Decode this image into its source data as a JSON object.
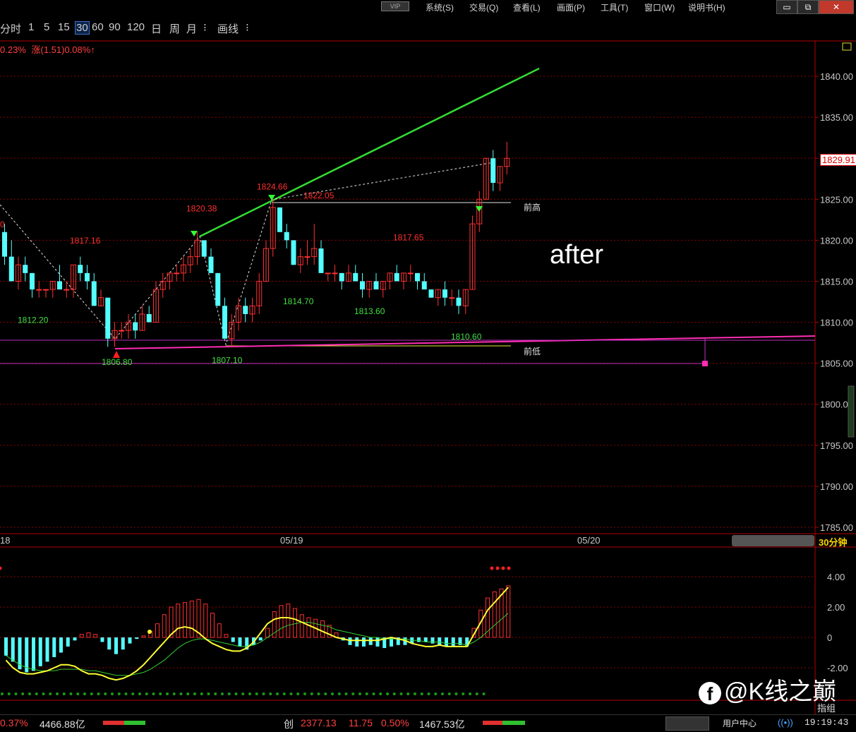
{
  "menu": {
    "vip": "VIP",
    "items": [
      "系统(S)",
      "交易(Q)",
      "查看(L)",
      "画面(P)",
      "工具(T)",
      "窗口(W)",
      "说明书(H)"
    ],
    "window_buttons": [
      "▭",
      "⧉",
      "✕"
    ]
  },
  "toolbar": {
    "items": [
      "分时",
      "1",
      "5",
      "15",
      "30",
      "60",
      "90",
      "120",
      "日",
      "周",
      "月",
      "⁝",
      "画线",
      "⁝"
    ],
    "selected": "30"
  },
  "info": {
    "left_pct": "0.23%",
    "change_label": "涨(1.51)",
    "change_pct": "0.08%",
    "arrow": "↑"
  },
  "chart_data": {
    "type": "candlestick",
    "price_axis": {
      "ticks": [
        "1840.00",
        "1835.00",
        "1830.00",
        "1825.00",
        "1820.00",
        "1815.00",
        "1810.00",
        "1805.00",
        "1800.00",
        "1795.00",
        "1790.00",
        "1785.00"
      ],
      "range": [
        1785,
        1841
      ],
      "current_price": "1829.91"
    },
    "date_labels": [
      "18",
      "05/19",
      "05/20"
    ],
    "period_label": "30分钟",
    "point_labels": [
      {
        "text": "1824.66",
        "price": 1826.2,
        "color": "#ff3030"
      },
      {
        "text": "1822.05",
        "price": 1825.1,
        "color": "#ff3030"
      },
      {
        "text": "1820.38",
        "price": 1823.5,
        "color": "#ff3030"
      },
      {
        "text": "1817.16",
        "price": 1819.6,
        "color": "#ff3030"
      },
      {
        "text": "1817.65",
        "price": 1820.0,
        "color": "#ff3030"
      },
      {
        "text": "1814.70",
        "price": 1812.2,
        "color": "#40e040"
      },
      {
        "text": "1813.60",
        "price": 1811.0,
        "color": "#40e040"
      },
      {
        "text": "1812.20",
        "price": 1809.9,
        "color": "#40e040"
      },
      {
        "text": "1810.60",
        "price": 1807.9,
        "color": "#40e040"
      },
      {
        "text": "1806.80",
        "price": 1804.8,
        "color": "#40e040"
      },
      {
        "text": "1807.10",
        "price": 1805.0,
        "color": "#40e040"
      },
      {
        "text": "0",
        "price": 1821.6,
        "color": "#ff3030"
      }
    ],
    "annotations": [
      {
        "text": "前高",
        "price": 1824.8
      },
      {
        "text": "前低",
        "price": 1807.1
      }
    ],
    "overlay_text": "after",
    "candles": [
      [
        1821,
        1822,
        1817,
        1818
      ],
      [
        1818,
        1820,
        1815,
        1815
      ],
      [
        1815,
        1818,
        1814,
        1817
      ],
      [
        1817,
        1818,
        1815,
        1816
      ],
      [
        1816,
        1816,
        1813,
        1814
      ],
      [
        1814,
        1815,
        1813,
        1814
      ],
      [
        1814,
        1814,
        1813,
        1814
      ],
      [
        1814,
        1815,
        1813,
        1815
      ],
      [
        1815,
        1817,
        1814,
        1814
      ],
      [
        1814,
        1815,
        1813,
        1814
      ],
      [
        1814,
        1817,
        1813,
        1817
      ],
      [
        1817,
        1818,
        1815,
        1816
      ],
      [
        1816,
        1817,
        1814,
        1815
      ],
      [
        1815,
        1816,
        1812,
        1812
      ],
      [
        1812,
        1814,
        1812,
        1813
      ],
      [
        1813,
        1813,
        1807,
        1808
      ],
      [
        1808,
        1810,
        1807,
        1809
      ],
      [
        1809,
        1810,
        1808,
        1809
      ],
      [
        1809,
        1811,
        1808,
        1810
      ],
      [
        1810,
        1811,
        1808,
        1809
      ],
      [
        1809,
        1812,
        1809,
        1811
      ],
      [
        1811,
        1812,
        1810,
        1810
      ],
      [
        1810,
        1815,
        1810,
        1814
      ],
      [
        1814,
        1816,
        1813,
        1815
      ],
      [
        1815,
        1816,
        1814,
        1816
      ],
      [
        1816,
        1817,
        1815,
        1816
      ],
      [
        1816,
        1818,
        1815,
        1817
      ],
      [
        1817,
        1819,
        1816,
        1818
      ],
      [
        1818,
        1821,
        1817,
        1820
      ],
      [
        1820,
        1820,
        1818,
        1818
      ],
      [
        1818,
        1819,
        1816,
        1816
      ],
      [
        1816,
        1816,
        1812,
        1812
      ],
      [
        1812,
        1813,
        1808,
        1808
      ],
      [
        1808,
        1811,
        1807,
        1810
      ],
      [
        1810,
        1813,
        1809,
        1812
      ],
      [
        1812,
        1813,
        1810,
        1811
      ],
      [
        1811,
        1813,
        1810,
        1812
      ],
      [
        1812,
        1816,
        1811,
        1815
      ],
      [
        1815,
        1820,
        1815,
        1819
      ],
      [
        1819,
        1825,
        1818,
        1824
      ],
      [
        1824,
        1824,
        1821,
        1821
      ],
      [
        1821,
        1822,
        1819,
        1820
      ],
      [
        1820,
        1820,
        1817,
        1817
      ],
      [
        1817,
        1819,
        1816,
        1818
      ],
      [
        1818,
        1820,
        1817,
        1818
      ],
      [
        1818,
        1822,
        1817,
        1819
      ],
      [
        1819,
        1820,
        1816,
        1816
      ],
      [
        1816,
        1816,
        1815,
        1816
      ],
      [
        1816,
        1817,
        1815,
        1816
      ],
      [
        1816,
        1816,
        1814,
        1815
      ],
      [
        1815,
        1817,
        1815,
        1816
      ],
      [
        1816,
        1817,
        1815,
        1815
      ],
      [
        1815,
        1816,
        1813,
        1814
      ],
      [
        1814,
        1815,
        1813,
        1815
      ],
      [
        1815,
        1816,
        1814,
        1814
      ],
      [
        1814,
        1815,
        1813,
        1815
      ],
      [
        1815,
        1816,
        1814,
        1816
      ],
      [
        1816,
        1817,
        1815,
        1815
      ],
      [
        1815,
        1816,
        1814,
        1816
      ],
      [
        1816,
        1817,
        1815,
        1816
      ],
      [
        1816,
        1816,
        1814,
        1815
      ],
      [
        1815,
        1816,
        1814,
        1814
      ],
      [
        1814,
        1814,
        1813,
        1813
      ],
      [
        1813,
        1814,
        1812,
        1814
      ],
      [
        1814,
        1815,
        1812,
        1813
      ],
      [
        1813,
        1814,
        1812,
        1813
      ],
      [
        1813,
        1814,
        1811,
        1812
      ],
      [
        1812,
        1814,
        1811,
        1814
      ],
      [
        1814,
        1823,
        1814,
        1822
      ],
      [
        1822,
        1826,
        1821,
        1825
      ],
      [
        1825,
        1830,
        1825,
        1830
      ],
      [
        1830,
        1831,
        1826,
        1827
      ],
      [
        1827,
        1829,
        1826,
        1829
      ],
      [
        1829,
        1832,
        1828,
        1830
      ]
    ],
    "indicator": {
      "ticks": [
        "4.00",
        "2.00",
        "0",
        "-2.00"
      ],
      "range": [
        -3.5,
        5.5
      ],
      "histogram": [
        -1.2,
        -1.6,
        -2.1,
        -2.3,
        -2.2,
        -1.9,
        -1.6,
        -1.3,
        -1.0,
        -0.6,
        -0.2,
        0.2,
        0.3,
        0.2,
        -0.3,
        -0.8,
        -1.1,
        -0.8,
        -0.4,
        -0.1,
        0.1,
        0.4,
        0.9,
        1.5,
        2.0,
        2.2,
        2.3,
        2.4,
        2.5,
        2.2,
        1.6,
        0.9,
        0.2,
        -0.3,
        -0.6,
        -0.8,
        -0.5,
        -0.2,
        0.6,
        1.7,
        2.1,
        2.2,
        1.9,
        1.5,
        1.3,
        1.2,
        1.1,
        0.8,
        0.3,
        -0.2,
        -0.5,
        -0.6,
        -0.6,
        -0.5,
        -0.6,
        -0.7,
        -0.6,
        -0.5,
        -0.5,
        -0.4,
        -0.3,
        -0.3,
        -0.4,
        -0.5,
        -0.6,
        -0.6,
        -0.5,
        -0.6,
        0.6,
        1.8,
        2.6,
        3.0,
        3.2,
        3.4
      ],
      "dif": [
        -1.5,
        -2.0,
        -2.3,
        -2.4,
        -2.4,
        -2.3,
        -2.2,
        -2.0,
        -1.8,
        -1.8,
        -1.9,
        -2.2,
        -2.4,
        -2.4,
        -2.5,
        -2.7,
        -2.8,
        -2.7,
        -2.5,
        -2.2,
        -1.8,
        -1.3,
        -0.8,
        -0.3,
        0.2,
        0.6,
        0.7,
        0.6,
        0.3,
        -0.1,
        -0.4,
        -0.6,
        -0.8,
        -0.9,
        -0.9,
        -0.7,
        -0.3,
        0.3,
        0.9,
        1.2,
        1.3,
        1.3,
        1.2,
        1.0,
        0.8,
        0.6,
        0.4,
        0.2,
        0.0,
        -0.1,
        -0.2,
        -0.2,
        -0.2,
        -0.2,
        -0.2,
        -0.1,
        0.0,
        -0.1,
        -0.2,
        -0.4,
        -0.5,
        -0.6,
        -0.6,
        -0.5,
        -0.6,
        -0.6,
        -0.6,
        -0.6,
        0.2,
        1.0,
        1.8,
        2.3,
        2.8,
        3.3
      ],
      "dea": [
        -1.2,
        -1.5,
        -1.8,
        -2.0,
        -2.1,
        -2.2,
        -2.2,
        -2.2,
        -2.1,
        -2.1,
        -2.1,
        -2.1,
        -2.2,
        -2.2,
        -2.3,
        -2.4,
        -2.5,
        -2.5,
        -2.5,
        -2.4,
        -2.3,
        -2.1,
        -1.8,
        -1.5,
        -1.1,
        -0.7,
        -0.4,
        -0.2,
        -0.1,
        -0.1,
        -0.2,
        -0.3,
        -0.4,
        -0.5,
        -0.6,
        -0.6,
        -0.5,
        -0.3,
        0.0,
        0.3,
        0.6,
        0.8,
        0.9,
        1.0,
        1.0,
        0.9,
        0.8,
        0.7,
        0.5,
        0.4,
        0.3,
        0.2,
        0.1,
        0.0,
        0.0,
        -0.1,
        -0.1,
        -0.1,
        -0.1,
        -0.2,
        -0.2,
        -0.3,
        -0.3,
        -0.3,
        -0.4,
        -0.4,
        -0.4,
        -0.5,
        -0.3,
        0.0,
        0.4,
        0.8,
        1.2,
        1.6
      ]
    }
  },
  "watermark": "@K线之巅",
  "status": {
    "left_pct": "0.37%",
    "left_amount": "4466.88亿",
    "chuang": "创",
    "chuang_val": "2377.13",
    "chuang_chg": "11.75",
    "chuang_pct": "0.50%",
    "chuang_amount": "1467.53亿",
    "user_center": "用户中心",
    "time": "19:19:43",
    "side_label": "指组"
  }
}
